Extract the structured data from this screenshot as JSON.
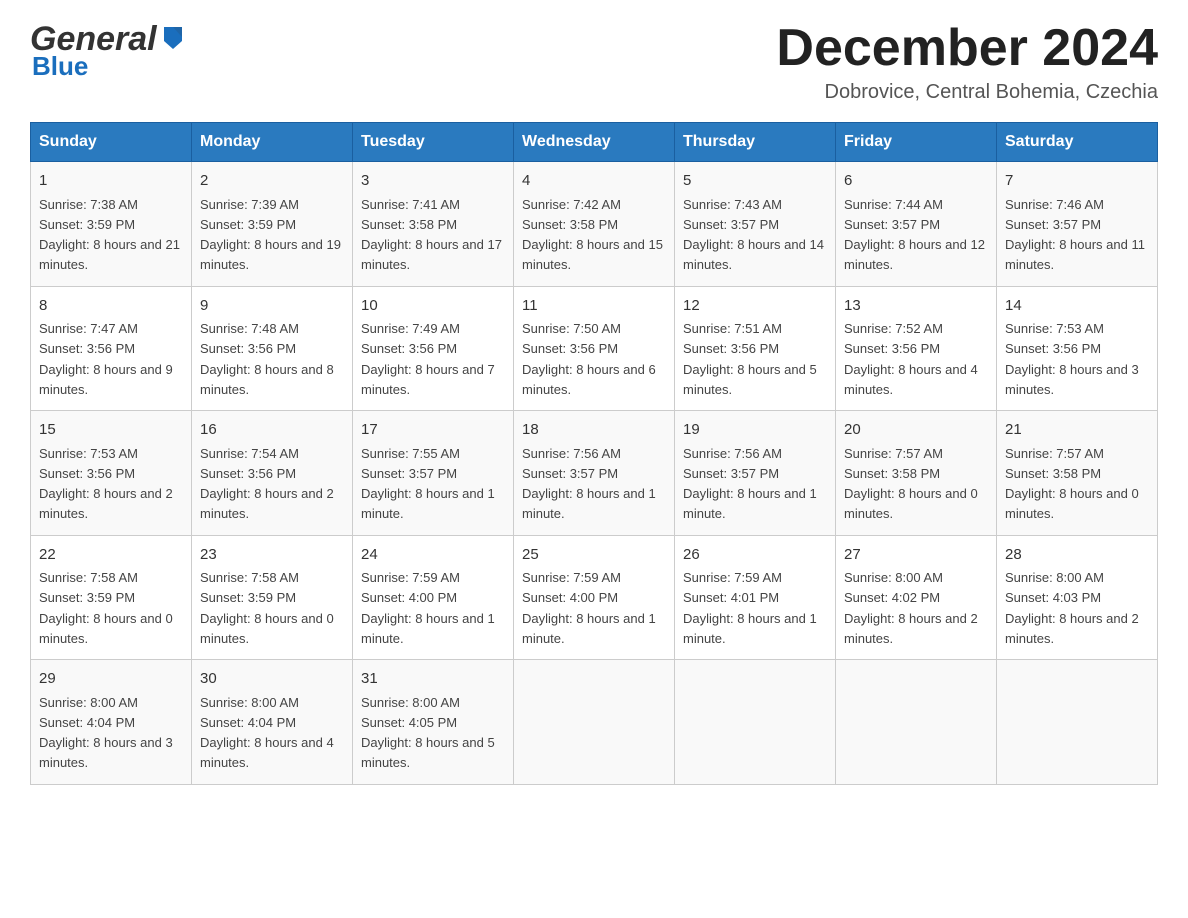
{
  "header": {
    "logo_general": "General",
    "logo_blue": "Blue",
    "month_title": "December 2024",
    "location": "Dobrovice, Central Bohemia, Czechia"
  },
  "days_of_week": [
    "Sunday",
    "Monday",
    "Tuesday",
    "Wednesday",
    "Thursday",
    "Friday",
    "Saturday"
  ],
  "weeks": [
    [
      {
        "day": "1",
        "sunrise": "7:38 AM",
        "sunset": "3:59 PM",
        "daylight": "8 hours and 21 minutes."
      },
      {
        "day": "2",
        "sunrise": "7:39 AM",
        "sunset": "3:59 PM",
        "daylight": "8 hours and 19 minutes."
      },
      {
        "day": "3",
        "sunrise": "7:41 AM",
        "sunset": "3:58 PM",
        "daylight": "8 hours and 17 minutes."
      },
      {
        "day": "4",
        "sunrise": "7:42 AM",
        "sunset": "3:58 PM",
        "daylight": "8 hours and 15 minutes."
      },
      {
        "day": "5",
        "sunrise": "7:43 AM",
        "sunset": "3:57 PM",
        "daylight": "8 hours and 14 minutes."
      },
      {
        "day": "6",
        "sunrise": "7:44 AM",
        "sunset": "3:57 PM",
        "daylight": "8 hours and 12 minutes."
      },
      {
        "day": "7",
        "sunrise": "7:46 AM",
        "sunset": "3:57 PM",
        "daylight": "8 hours and 11 minutes."
      }
    ],
    [
      {
        "day": "8",
        "sunrise": "7:47 AM",
        "sunset": "3:56 PM",
        "daylight": "8 hours and 9 minutes."
      },
      {
        "day": "9",
        "sunrise": "7:48 AM",
        "sunset": "3:56 PM",
        "daylight": "8 hours and 8 minutes."
      },
      {
        "day": "10",
        "sunrise": "7:49 AM",
        "sunset": "3:56 PM",
        "daylight": "8 hours and 7 minutes."
      },
      {
        "day": "11",
        "sunrise": "7:50 AM",
        "sunset": "3:56 PM",
        "daylight": "8 hours and 6 minutes."
      },
      {
        "day": "12",
        "sunrise": "7:51 AM",
        "sunset": "3:56 PM",
        "daylight": "8 hours and 5 minutes."
      },
      {
        "day": "13",
        "sunrise": "7:52 AM",
        "sunset": "3:56 PM",
        "daylight": "8 hours and 4 minutes."
      },
      {
        "day": "14",
        "sunrise": "7:53 AM",
        "sunset": "3:56 PM",
        "daylight": "8 hours and 3 minutes."
      }
    ],
    [
      {
        "day": "15",
        "sunrise": "7:53 AM",
        "sunset": "3:56 PM",
        "daylight": "8 hours and 2 minutes."
      },
      {
        "day": "16",
        "sunrise": "7:54 AM",
        "sunset": "3:56 PM",
        "daylight": "8 hours and 2 minutes."
      },
      {
        "day": "17",
        "sunrise": "7:55 AM",
        "sunset": "3:57 PM",
        "daylight": "8 hours and 1 minute."
      },
      {
        "day": "18",
        "sunrise": "7:56 AM",
        "sunset": "3:57 PM",
        "daylight": "8 hours and 1 minute."
      },
      {
        "day": "19",
        "sunrise": "7:56 AM",
        "sunset": "3:57 PM",
        "daylight": "8 hours and 1 minute."
      },
      {
        "day": "20",
        "sunrise": "7:57 AM",
        "sunset": "3:58 PM",
        "daylight": "8 hours and 0 minutes."
      },
      {
        "day": "21",
        "sunrise": "7:57 AM",
        "sunset": "3:58 PM",
        "daylight": "8 hours and 0 minutes."
      }
    ],
    [
      {
        "day": "22",
        "sunrise": "7:58 AM",
        "sunset": "3:59 PM",
        "daylight": "8 hours and 0 minutes."
      },
      {
        "day": "23",
        "sunrise": "7:58 AM",
        "sunset": "3:59 PM",
        "daylight": "8 hours and 0 minutes."
      },
      {
        "day": "24",
        "sunrise": "7:59 AM",
        "sunset": "4:00 PM",
        "daylight": "8 hours and 1 minute."
      },
      {
        "day": "25",
        "sunrise": "7:59 AM",
        "sunset": "4:00 PM",
        "daylight": "8 hours and 1 minute."
      },
      {
        "day": "26",
        "sunrise": "7:59 AM",
        "sunset": "4:01 PM",
        "daylight": "8 hours and 1 minute."
      },
      {
        "day": "27",
        "sunrise": "8:00 AM",
        "sunset": "4:02 PM",
        "daylight": "8 hours and 2 minutes."
      },
      {
        "day": "28",
        "sunrise": "8:00 AM",
        "sunset": "4:03 PM",
        "daylight": "8 hours and 2 minutes."
      }
    ],
    [
      {
        "day": "29",
        "sunrise": "8:00 AM",
        "sunset": "4:04 PM",
        "daylight": "8 hours and 3 minutes."
      },
      {
        "day": "30",
        "sunrise": "8:00 AM",
        "sunset": "4:04 PM",
        "daylight": "8 hours and 4 minutes."
      },
      {
        "day": "31",
        "sunrise": "8:00 AM",
        "sunset": "4:05 PM",
        "daylight": "8 hours and 5 minutes."
      },
      null,
      null,
      null,
      null
    ]
  ],
  "cell_labels": {
    "sunrise": "Sunrise:",
    "sunset": "Sunset:",
    "daylight": "Daylight:"
  }
}
